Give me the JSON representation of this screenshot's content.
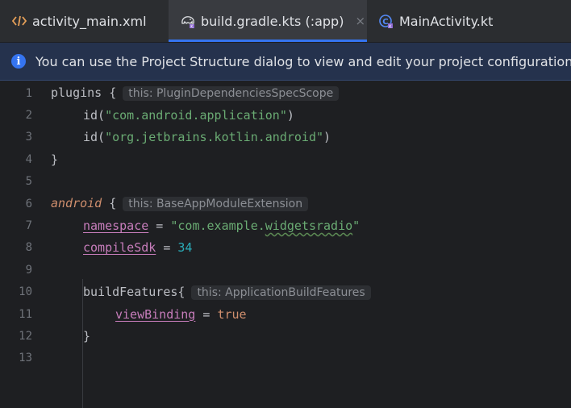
{
  "tabs": [
    {
      "label": "activity_main.xml",
      "icon": "xml-icon",
      "active": false
    },
    {
      "label": "build.gradle.kts (:app)",
      "icon": "gradle-elephant-icon",
      "active": true,
      "close": "×"
    },
    {
      "label": "MainActivity.kt",
      "icon": "kotlin-class-icon",
      "active": false
    }
  ],
  "banner": {
    "icon": "info-icon",
    "icon_glyph": "i",
    "text": "You can use the Project Structure dialog to view and edit your project configuration"
  },
  "editor": {
    "line_numbers": [
      "1",
      "2",
      "3",
      "4",
      "5",
      "6",
      "7",
      "8",
      "9",
      "10",
      "11",
      "12",
      "13"
    ],
    "lines": {
      "l1": {
        "code": "plugins {",
        "hint": "this: PluginDependenciesSpecScope"
      },
      "l2": {
        "pre": "id(",
        "str": "\"com.android.application\"",
        "post": ")"
      },
      "l3": {
        "pre": "id(",
        "str": "\"org.jetbrains.kotlin.android\"",
        "post": ")"
      },
      "l4": {
        "code": "}"
      },
      "l6": {
        "kw": "android",
        "rest": " {",
        "hint": "this: BaseAppModuleExtension"
      },
      "l7": {
        "prop": "namespace",
        "op": " = ",
        "str_a": "\"com.example.",
        "str_b": "widgetsradio",
        "str_c": "\""
      },
      "l8": {
        "prop": "compileSdk",
        "op": " = ",
        "num": "34"
      },
      "l10": {
        "code": "buildFeatures{",
        "hint": "this: ApplicationBuildFeatures"
      },
      "l11": {
        "prop": "viewBinding",
        "op": " = ",
        "kw": "true"
      },
      "l12": {
        "code": "}"
      }
    }
  },
  "colors": {
    "accent": "#3574f0",
    "string": "#6aab73",
    "keyword": "#cf8e6d",
    "property": "#c77dbb",
    "number": "#2aacb8"
  }
}
